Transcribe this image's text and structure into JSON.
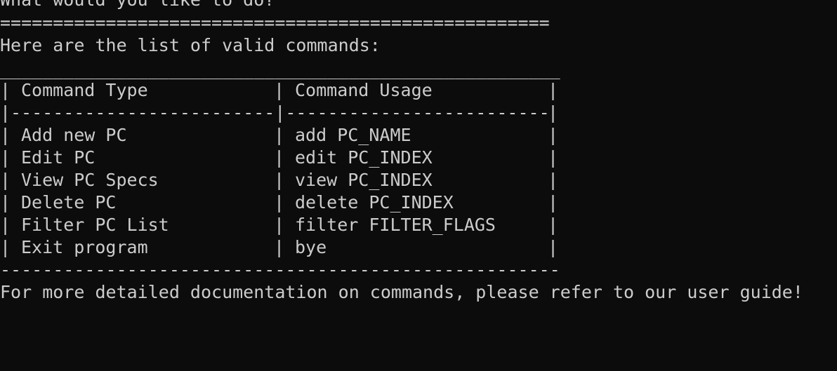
{
  "prompt_line": "What would you like to do?",
  "separator_line": "====================================================",
  "intro_text": "Here are the list of valid commands:",
  "table": {
    "top_border": "_____________________________________________________",
    "header_divider": "-------------------------|-------------------------",
    "bottom_border": "-----------------------------------------------------",
    "headers": {
      "type": "Command Type",
      "usage": "Command Usage"
    },
    "rows": [
      {
        "type": "Add new PC",
        "usage": "add PC_NAME"
      },
      {
        "type": "Edit PC",
        "usage": "edit PC_INDEX"
      },
      {
        "type": "View PC Specs",
        "usage": "view PC_INDEX"
      },
      {
        "type": "Delete PC",
        "usage": "delete PC_INDEX"
      },
      {
        "type": "Filter PC List",
        "usage": "filter FILTER_FLAGS"
      },
      {
        "type": "Exit program",
        "usage": "bye"
      }
    ]
  },
  "footer_text": "For more detailed documentation on commands, please refer to our user guide!"
}
